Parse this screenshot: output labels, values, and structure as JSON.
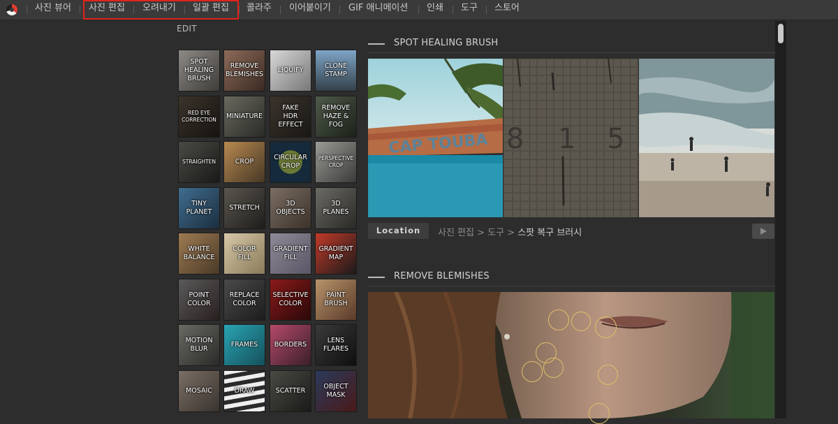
{
  "nav": {
    "items": [
      "사진 뷰어",
      "사진 편집",
      "오려내기",
      "일괄 편집",
      "콜라주",
      "이어붙이기",
      "GIF 애니메이션",
      "인쇄",
      "도구",
      "스토어"
    ]
  },
  "edit": {
    "title": "EDIT",
    "tools": [
      "SPOT\nHEALING\nBRUSH",
      "REMOVE\nBLEMISHES",
      "LIQUIFY",
      "CLONE\nSTAMP",
      "RED EYE\nCORRECTION",
      "MINIATURE",
      "FAKE\nHDR EFFECT",
      "REMOVE\nHAZE & FOG",
      "STRAIGHTEN",
      "CROP",
      "CIRCULAR\nCROP",
      "PERSPECTIVE\nCROP",
      "TINY\nPLANET",
      "STRETCH",
      "3D\nOBJECTS",
      "3D\nPLANES",
      "WHITE\nBALANCE",
      "COLOR\nFILL",
      "GRADIENT\nFILL",
      "GRADIENT\nMAP",
      "POINT\nCOLOR",
      "REPLACE\nCOLOR",
      "SELECTIVE\nCOLOR",
      "PAINT\nBRUSH",
      "MOTION\nBLUR",
      "FRAMES",
      "BORDERS",
      "LENS\nFLARES",
      "MOSAIC",
      "DRAW",
      "SCATTER",
      "OBJECT\nMASK"
    ]
  },
  "sections": [
    {
      "title": "SPOT HEALING BRUSH",
      "location_label": "Location",
      "breadcrumb": "사진 편집 > 도구 > ",
      "breadcrumb_current": "스팟 복구 브러시",
      "boat_text": "CAP TOUBA",
      "wall_numbers": [
        "8",
        "1",
        "5"
      ]
    },
    {
      "title": "REMOVE BLEMISHES"
    }
  ],
  "colors": {
    "accent_highlight": "#e2231a",
    "blemish_circle": "#e1bf6a",
    "panel_bg": "#2d2d2d"
  }
}
